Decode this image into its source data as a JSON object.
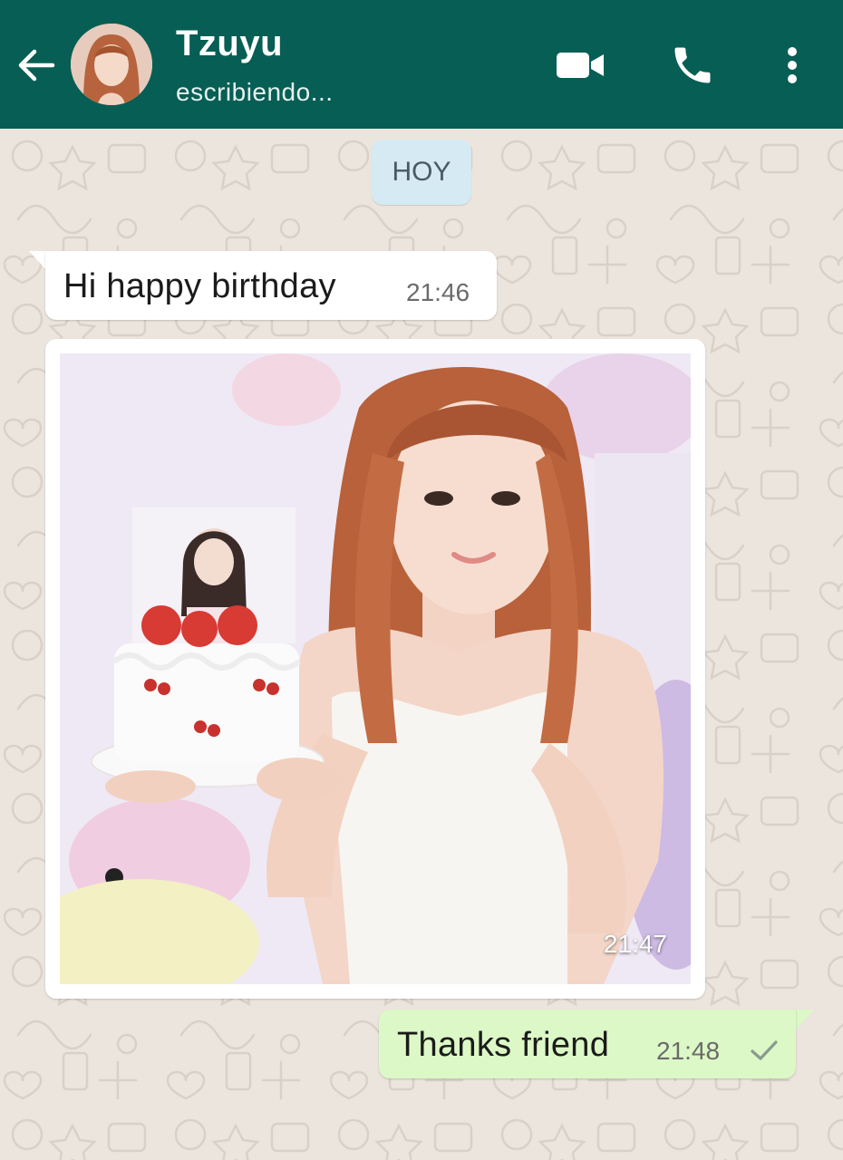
{
  "header": {
    "contact_name": "Tzuyu",
    "status": "escribiendo...",
    "bg_color": "#075e54",
    "icons": [
      "arrow-back-icon",
      "videocam-icon",
      "phone-icon",
      "more-vertical-icon"
    ]
  },
  "chat": {
    "date_label": "HOY",
    "messages": [
      {
        "direction": "incoming",
        "type": "text",
        "text": "Hi happy birthday",
        "time": "21:46"
      },
      {
        "direction": "incoming",
        "type": "image",
        "time": "21:47"
      },
      {
        "direction": "outgoing",
        "type": "text",
        "text": "Thanks friend",
        "time": "21:48",
        "status_icon": "single-check-icon"
      }
    ],
    "colors": {
      "background": "#ece5dd",
      "incoming": "#ffffff",
      "outgoing": "#dcf8c6",
      "date_pill": "#d5eaf3"
    }
  }
}
